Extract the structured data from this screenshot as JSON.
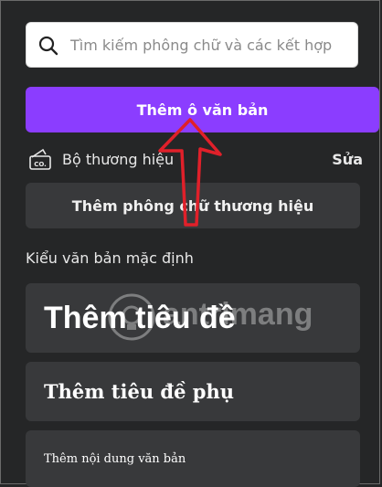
{
  "search": {
    "placeholder": "Tìm kiếm phông chữ và các kết hợp"
  },
  "add_textbox_button": {
    "label": "Thêm ô văn bản"
  },
  "brand_kit": {
    "label": "Bộ thương hiệu",
    "edit_label": "Sửa",
    "icon": "brand-kit-icon"
  },
  "add_brand_font_button": {
    "label": "Thêm phông chữ thương hiệu"
  },
  "default_styles": {
    "title": "Kiểu văn bản mặc định",
    "heading": "Thêm tiêu đề",
    "subheading": "Thêm tiêu đề phụ",
    "body": "Thêm nội dung văn bản"
  },
  "colors": {
    "accent": "#8b3dff",
    "panel": "#252627",
    "card": "#38393b",
    "annotation_arrow": "#e0202a"
  }
}
